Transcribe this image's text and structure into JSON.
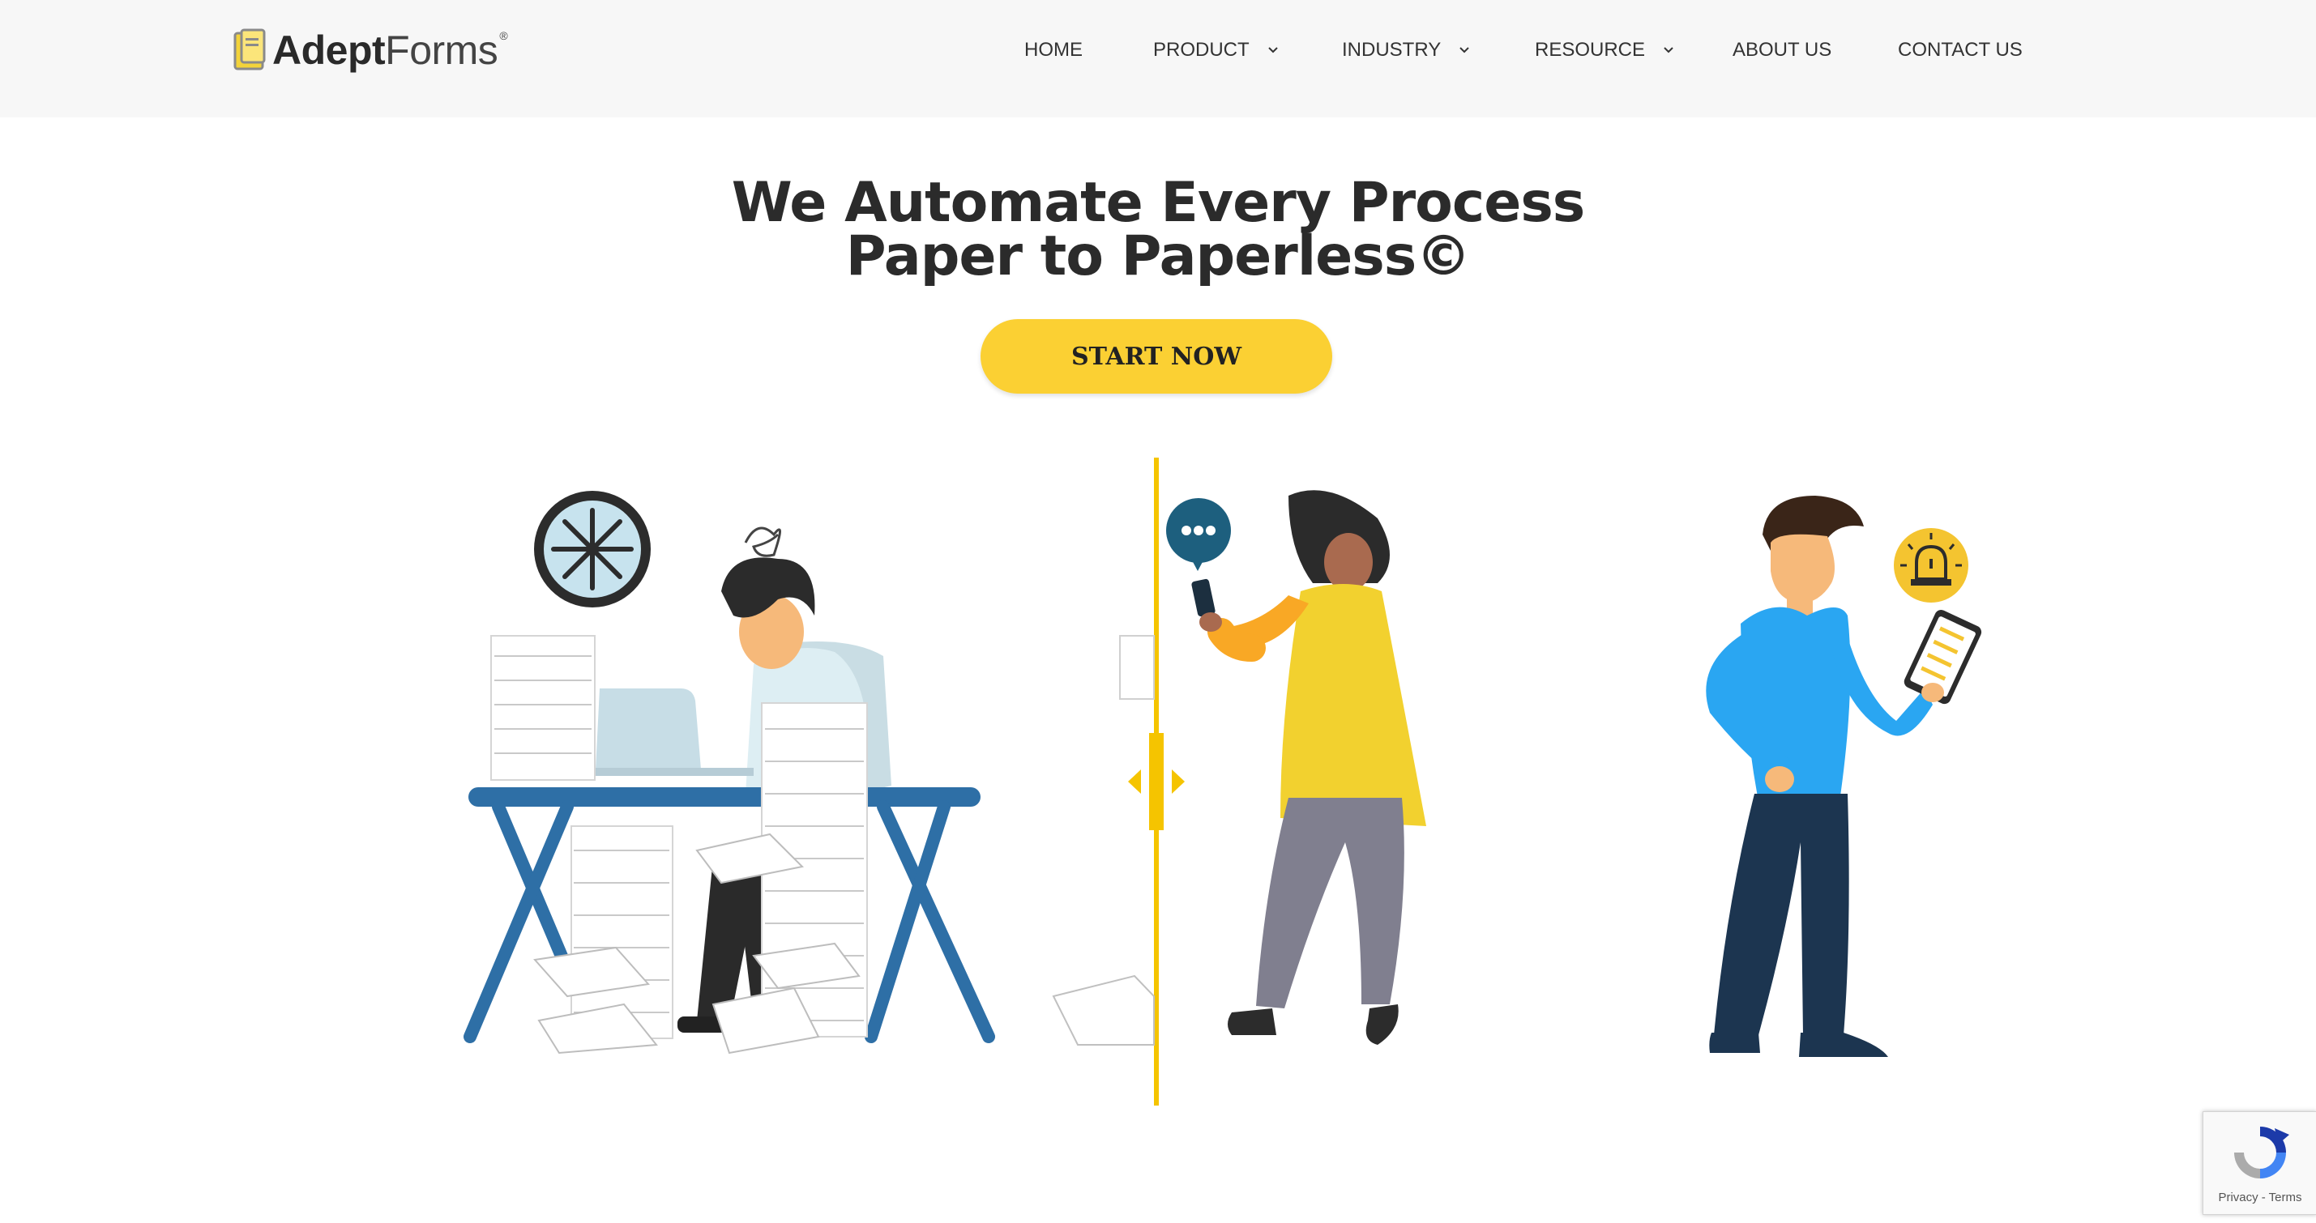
{
  "brand": {
    "name_bold": "Adept",
    "name_regular": "Forms",
    "registered": "®"
  },
  "nav": {
    "items": [
      {
        "label": "HOME"
      },
      {
        "label": "PRODUCT"
      },
      {
        "label": "INDUSTRY"
      },
      {
        "label": "RESOURCE"
      },
      {
        "label": "ABOUT US"
      },
      {
        "label": "CONTACT US"
      }
    ]
  },
  "hero": {
    "line1": "We Automate Every Process",
    "line2": "Paper to Paperless©",
    "cta_label": "START NOW"
  },
  "recaptcha": {
    "links": "Privacy - Terms"
  },
  "colors": {
    "accent_yellow": "#fbd033",
    "header_bg": "#f7f7f7",
    "desk_blue": "#2e6fa6",
    "shirt_blue": "#2aa6f2",
    "navy": "#1c3550"
  }
}
